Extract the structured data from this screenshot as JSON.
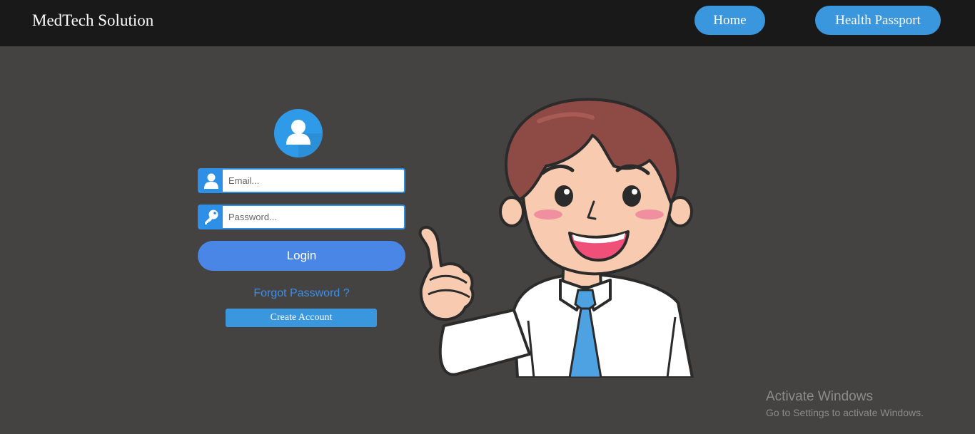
{
  "navbar": {
    "brand": "MedTech Solution",
    "home_label": "Home",
    "passport_label": "Health Passport"
  },
  "login": {
    "avatar_icon": "user-circle-icon",
    "email": {
      "placeholder": "Email...",
      "value": "",
      "icon": "user-icon"
    },
    "password": {
      "placeholder": "Password...",
      "value": "",
      "icon": "key-icon"
    },
    "login_label": "Login",
    "forgot_label": "Forgot Password ?",
    "create_label": "Create Account"
  },
  "illustration": {
    "name": "pointing-man-illustration"
  },
  "watermark": {
    "title": "Activate Windows",
    "subtitle": "Go to Settings to activate Windows."
  },
  "colors": {
    "navbar": "#191919",
    "background": "#454341",
    "accent": "#3a96dd",
    "login_button": "#4a86e6",
    "link": "#3d8fe6"
  }
}
